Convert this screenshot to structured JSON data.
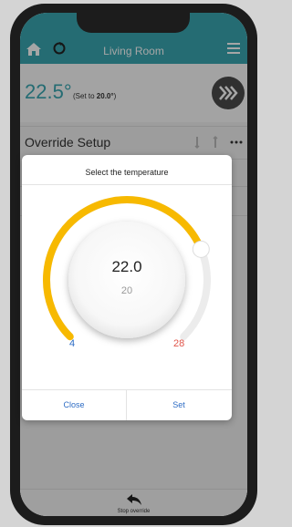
{
  "header": {
    "title": "Living Room"
  },
  "status": {
    "current_temp": "22.5°",
    "set_prefix": "(Set to ",
    "set_value": "20.0°",
    "set_suffix": ")"
  },
  "section": {
    "title": "Override Setup",
    "more_label": "•••"
  },
  "dialog": {
    "title": "Select the temperature",
    "selected_value": "22.0",
    "current_setpoint": "20",
    "min_label": "4",
    "max_label": "28",
    "selected_fraction": 0.75,
    "close_label": "Close",
    "set_label": "Set"
  },
  "footer": {
    "label": "Stop override"
  },
  "colors": {
    "accent": "#3aa7b1",
    "dial_fill": "#f7b900",
    "min_color": "#2d6cc4",
    "max_color": "#e0554a"
  }
}
